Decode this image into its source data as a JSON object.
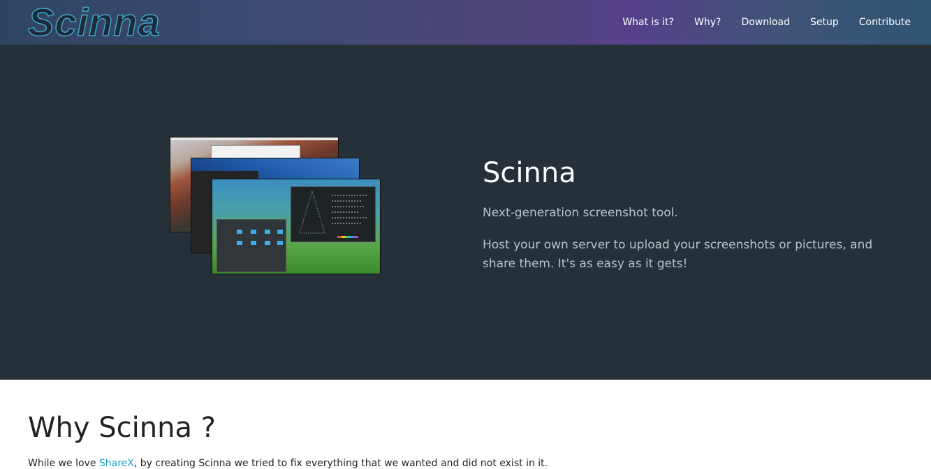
{
  "brand": {
    "logo_text": "Scinna"
  },
  "nav": {
    "items": [
      {
        "label": "What is it?"
      },
      {
        "label": "Why?"
      },
      {
        "label": "Download"
      },
      {
        "label": "Setup"
      },
      {
        "label": "Contribute"
      }
    ]
  },
  "hero": {
    "title": "Scinna",
    "subtitle": "Next-generation screenshot tool.",
    "description": "Host your own server to upload your screenshots or pictures, and share them. It's as easy as it gets!"
  },
  "why": {
    "title": "Why Scinna ?",
    "text_before": "While we love ",
    "link_label": "ShareX",
    "text_after": ", by creating Scinna we tried to fix everything that we wanted and did not exist in it."
  },
  "colors": {
    "hero_bg": "#263038",
    "link": "#1ea0c8",
    "logo_outline": "#3fa7c4"
  }
}
